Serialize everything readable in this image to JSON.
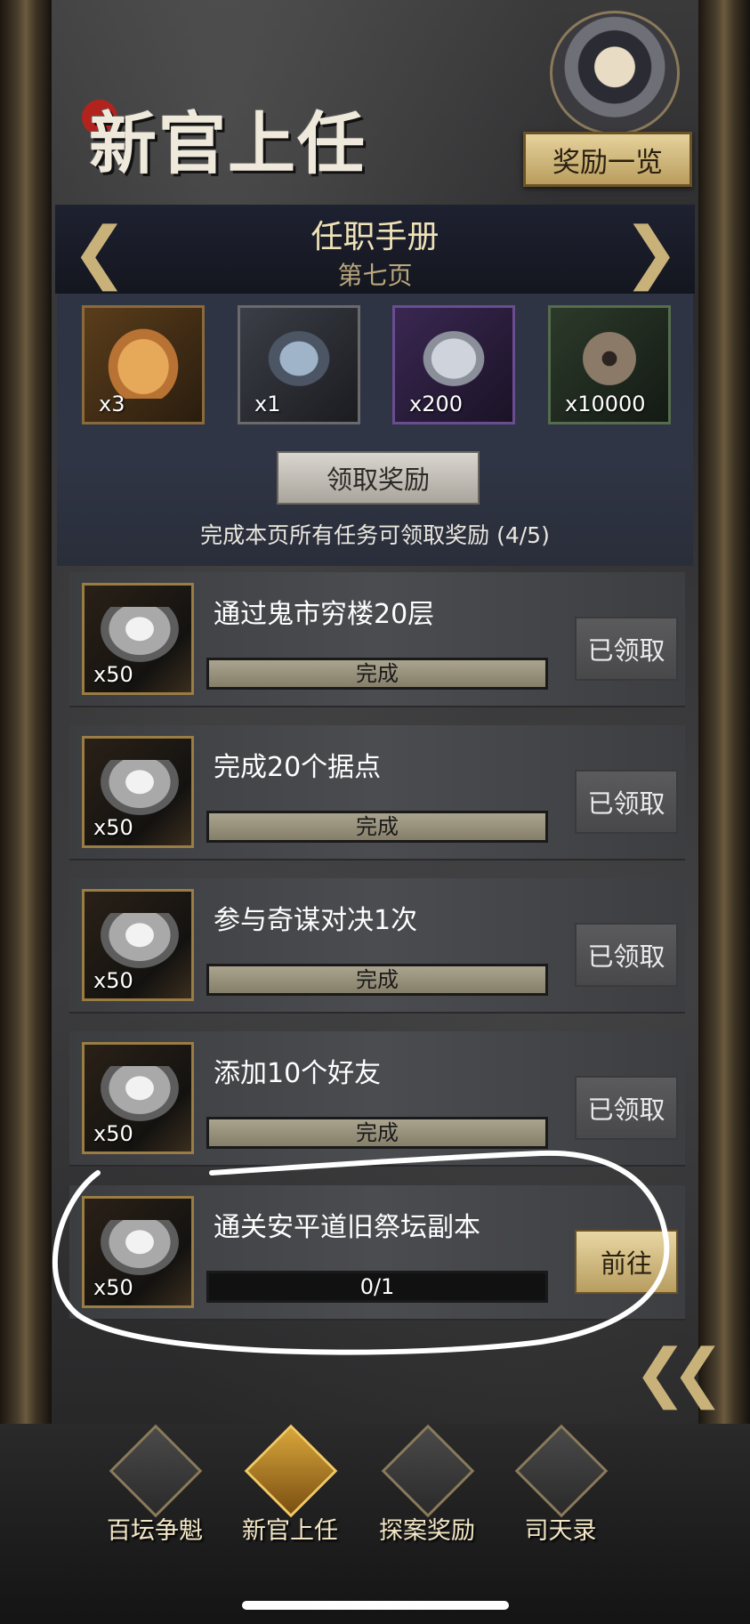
{
  "header": {
    "title": "新官上任",
    "reward_list_button": "奖励一览"
  },
  "manual": {
    "title": "任职手册",
    "page": "第七页",
    "prev_arrow": "❮",
    "next_arrow": "❯"
  },
  "page_rewards": [
    {
      "icon": "pouch-icon",
      "qty": "x3"
    },
    {
      "icon": "orb-icon",
      "qty": "x1"
    },
    {
      "icon": "ore-icon",
      "qty": "x200"
    },
    {
      "icon": "coin-icon",
      "qty": "x10000"
    }
  ],
  "claim_button": "领取奖励",
  "complete_hint": "完成本页所有任务可领取奖励 (4/5)",
  "tasks": [
    {
      "name": "通过鬼市穷楼20层",
      "reward_qty": "x50",
      "progress_text": "完成",
      "progress": 1.0,
      "button": "已领取"
    },
    {
      "name": "完成20个据点",
      "reward_qty": "x50",
      "progress_text": "完成",
      "progress": 1.0,
      "button": "已领取"
    },
    {
      "name": "参与奇谋对决1次",
      "reward_qty": "x50",
      "progress_text": "完成",
      "progress": 1.0,
      "button": "已领取"
    },
    {
      "name": "添加10个好友",
      "reward_qty": "x50",
      "progress_text": "完成",
      "progress": 1.0,
      "button": "已领取"
    },
    {
      "name": "通关安平道旧祭坛副本",
      "reward_qty": "x50",
      "progress_text": "0/1",
      "progress": 0.0,
      "button": "前往"
    }
  ],
  "back_button": "❮❮",
  "bottom_nav": [
    {
      "label": "百坛争魁",
      "icon": "altar-icon"
    },
    {
      "label": "新官上任",
      "icon": "lion-statue-icon"
    },
    {
      "label": "探案奖励",
      "icon": "chest-icon"
    },
    {
      "label": "司天录",
      "icon": "bronze-censer-icon"
    }
  ],
  "colors": {
    "accent_gold": "#c9b27a",
    "button_gold": "#e6d29c",
    "annotation_circle": "#ffffff"
  }
}
